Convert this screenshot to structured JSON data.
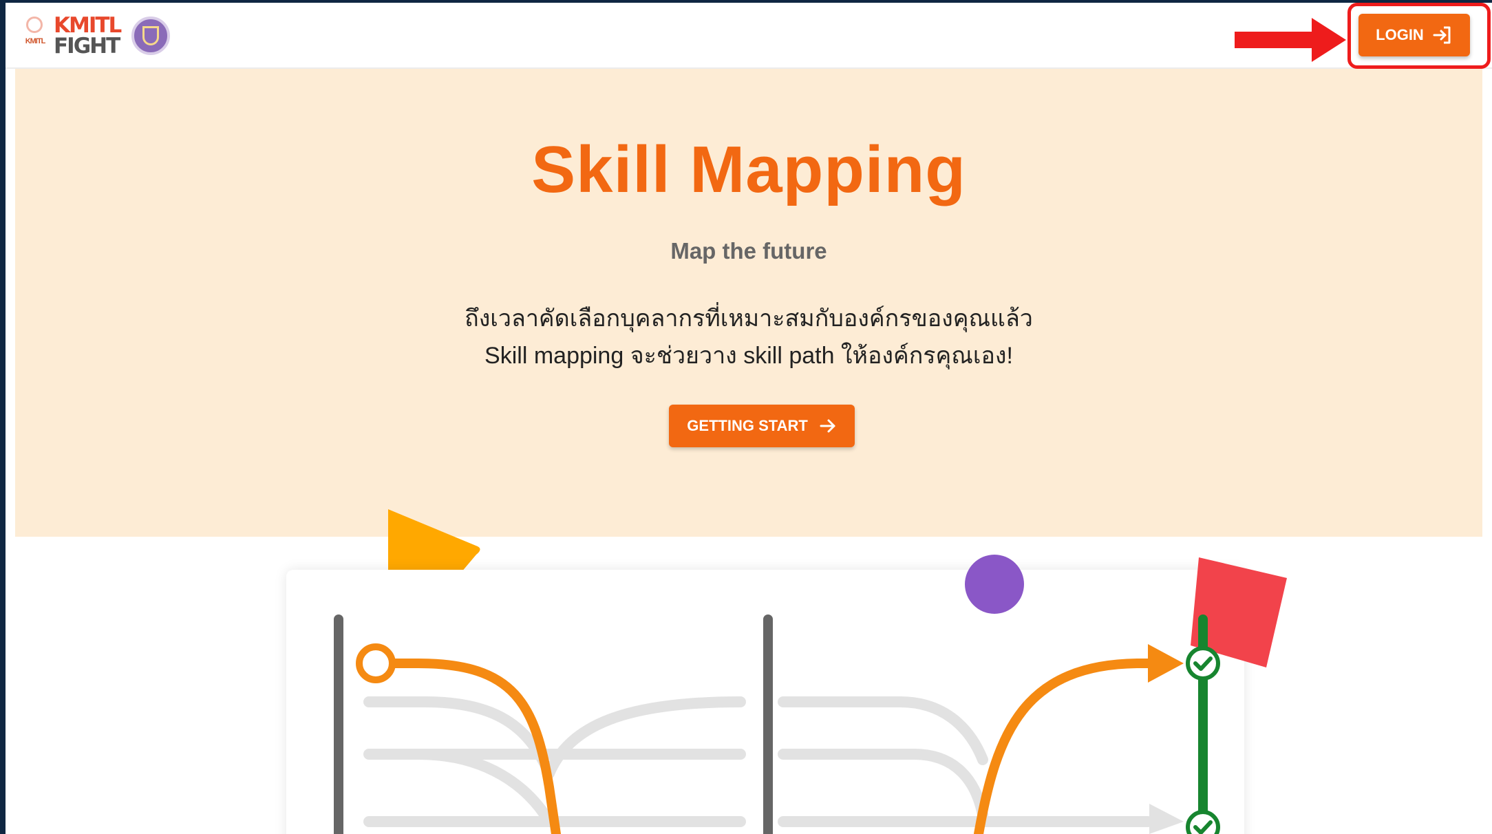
{
  "brand": {
    "seal_text": "KMITL",
    "wordmark_line1": "KMITL",
    "wordmark_line2": "FIGHT"
  },
  "nav": {
    "login_label": "LOGIN"
  },
  "hero": {
    "title": "Skill Mapping",
    "subtitle": "Map the future",
    "description_line1": "ถึงเวลาคัดเลือกบุคลากรที่เหมาะสมกับองค์กรของคุณแล้ว",
    "description_line2": "Skill mapping จะช่วยวาง skill path ให้องค์กรคุณเอง!",
    "cta_label": "GETTING START"
  },
  "colors": {
    "brand_orange": "#f26812",
    "hero_background": "#fdecd5",
    "annotation_red": "#ee1c1c",
    "path_green": "#17852f",
    "shape_yellow": "#ffa800",
    "shape_purple": "#8a57c7",
    "shape_red": "#f2434b"
  },
  "icons": {
    "login": "login-icon",
    "cta": "arrow-right-icon",
    "checkpoints": "check-circle-icon"
  }
}
